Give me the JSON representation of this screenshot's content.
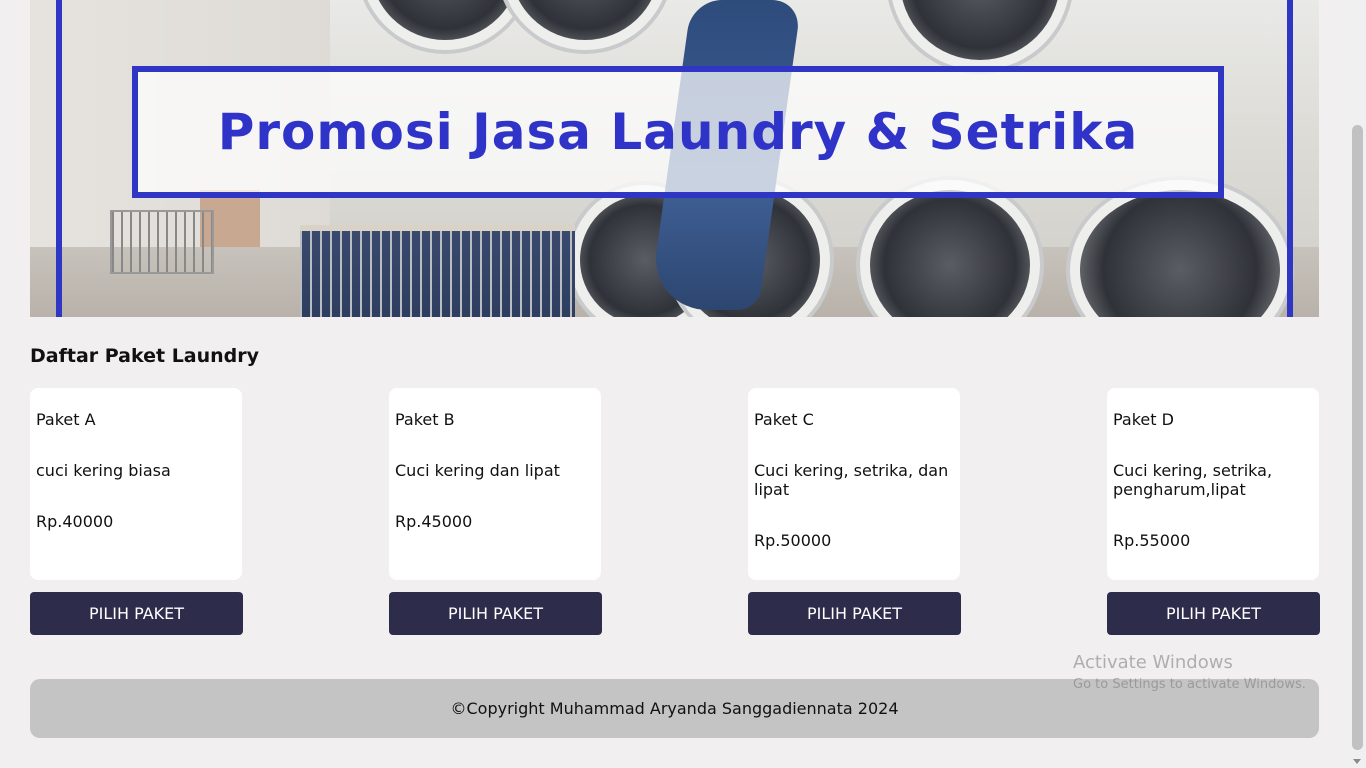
{
  "banner": {
    "title": "Promosi Jasa Laundry & Setrika"
  },
  "section": {
    "title": "Daftar Paket Laundry"
  },
  "packages": [
    {
      "name": "Paket A",
      "description": "cuci kering biasa",
      "price": "Rp.40000",
      "button_label": "PILIH PAKET"
    },
    {
      "name": "Paket B",
      "description": "Cuci kering dan lipat",
      "price": "Rp.45000",
      "button_label": "PILIH PAKET"
    },
    {
      "name": "Paket C",
      "description": "Cuci kering, setrika, dan lipat",
      "price": "Rp.50000",
      "button_label": "PILIH PAKET"
    },
    {
      "name": "Paket D",
      "description": "Cuci kering, setrika, pengharum,lipat",
      "price": "Rp.55000",
      "button_label": "PILIH PAKET"
    }
  ],
  "footer": {
    "copyright": "©Copyright Muhammad Aryanda Sanggadiennata 2024"
  },
  "watermark": {
    "line1": "Activate Windows",
    "line2": "Go to Settings to activate Windows."
  },
  "colors": {
    "background": "#f2eff0",
    "button": "#2e2c4b",
    "banner_accent": "#3036c4",
    "footer": "#c4c4c4"
  }
}
